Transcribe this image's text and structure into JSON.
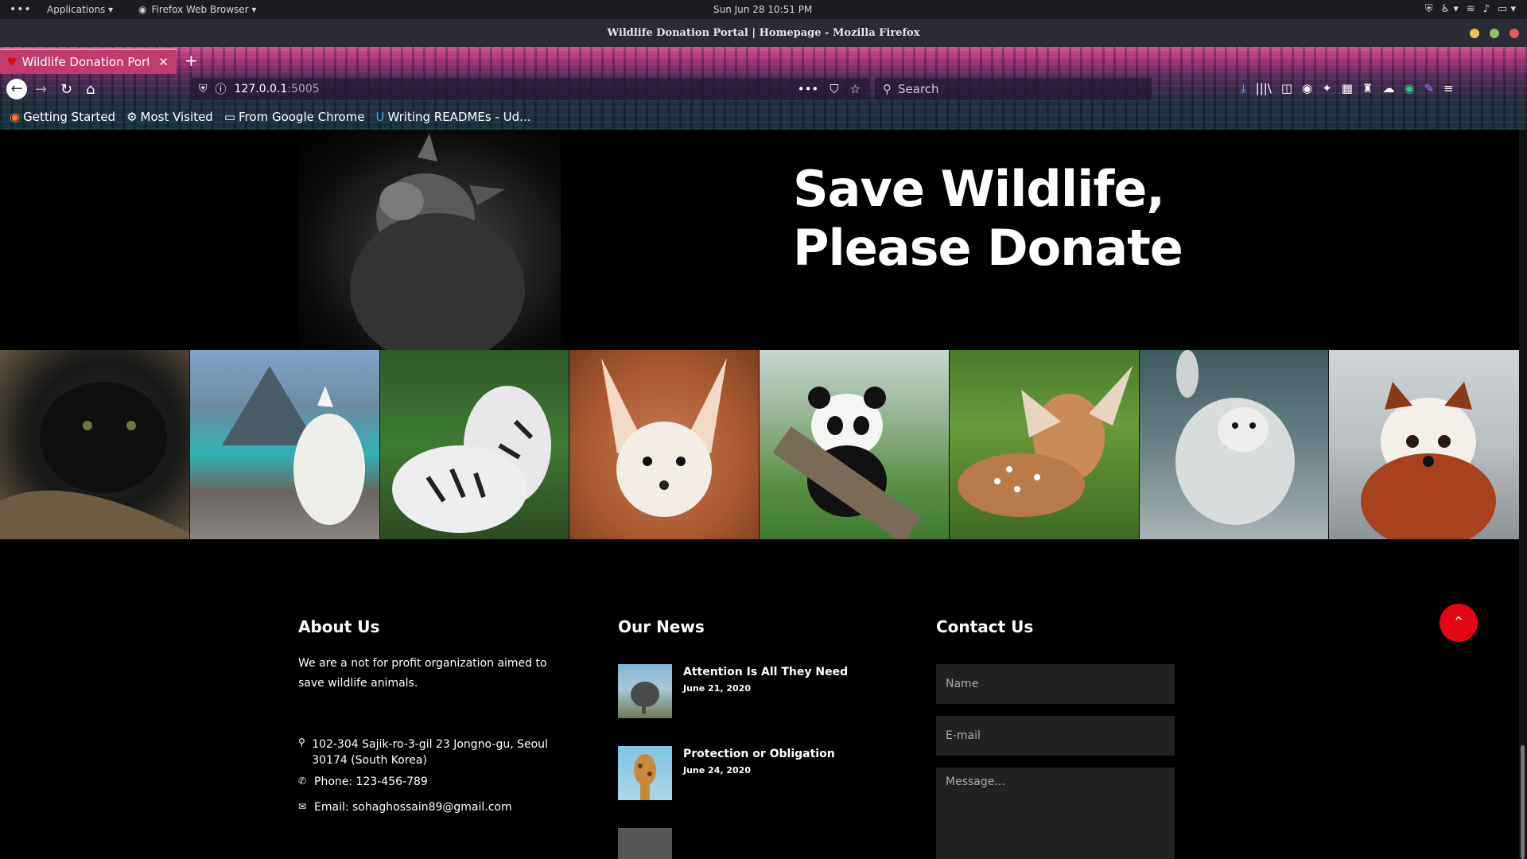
{
  "system_bar": {
    "applications": "Applications ▾",
    "firefox_app": "Firefox Web Browser ▾",
    "clock": "Sun Jun 28  10:51 PM"
  },
  "window": {
    "title": "Wildlife Donation Portal | Homepage - Mozilla Firefox"
  },
  "browser": {
    "tab_label": "Wildlife Donation Portal",
    "url_host": "127.0.0.1",
    "url_port": ":5005",
    "search_placeholder": "Search",
    "bookmarks": [
      "Getting Started",
      "Most Visited",
      "From Google Chrome",
      "Writing READMEs - Ud..."
    ]
  },
  "hero": {
    "title": "Save Wildlife,\nPlease Donate"
  },
  "gallery": {
    "animals": [
      "black-panther",
      "white-wolf",
      "white-tigers",
      "fennec-fox",
      "panda",
      "fawn",
      "sea-otter",
      "red-panda"
    ]
  },
  "footer": {
    "about": {
      "title": "About Us",
      "text": "We are a not for profit organization aimed to save wildlife animals.",
      "address": "102-304 Sajik-ro-3-gil 23 Jongno-gu, Seoul 30174 (South Korea)",
      "phone": "Phone: 123-456-789",
      "email": "Email: sohaghossain89@gmail.com"
    },
    "news": {
      "title": "Our News",
      "items": [
        {
          "title": "Attention Is All They Need",
          "date": "June 21, 2020"
        },
        {
          "title": "Protection or Obligation",
          "date": "June 24, 2020"
        }
      ]
    },
    "contact": {
      "title": "Contact Us",
      "name_placeholder": "Name",
      "email_placeholder": "E-mail",
      "message_placeholder": "Message..."
    }
  },
  "colors": {
    "accent_red": "#e30613",
    "tab_pink": "#c23b6e",
    "page_bg": "#000000"
  }
}
